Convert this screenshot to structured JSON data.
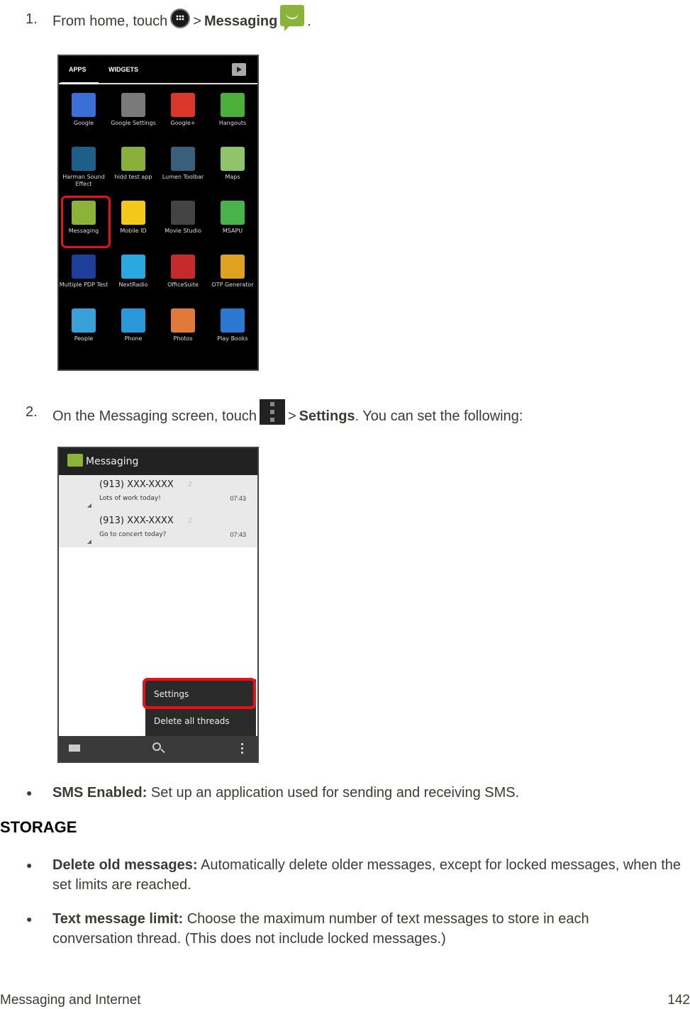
{
  "steps": [
    {
      "number": "1.",
      "prefix": "From home, touch",
      "icon1": "apps-icon",
      "separator": ">",
      "bold": "Messaging",
      "icon2": "messaging-icon",
      "suffix": "."
    },
    {
      "number": "2.",
      "prefix": "On the Messaging screen, touch",
      "icon1": "menu-icon",
      "separator": ">",
      "bold": "Settings",
      "suffix": ". You can set the following:"
    }
  ],
  "app_drawer": {
    "tabs": [
      "APPS",
      "WIDGETS"
    ],
    "apps": [
      {
        "label": "Google",
        "color": "#3b6fd8"
      },
      {
        "label": "Google Settings",
        "color": "#7a7a7a"
      },
      {
        "label": "Google+",
        "color": "#d9372a"
      },
      {
        "label": "Hangouts",
        "color": "#4caf3a"
      },
      {
        "label": "Harman Sound Effect",
        "color": "#1e5f8a"
      },
      {
        "label": "hidd test app",
        "color": "#8ab03c"
      },
      {
        "label": "Lumen Toolbar",
        "color": "#3a5f7a"
      },
      {
        "label": "Maps",
        "color": "#8fc46a"
      },
      {
        "label": "Messaging",
        "color": "#8bb33a",
        "highlighted": true
      },
      {
        "label": "Mobile ID",
        "color": "#f2c81a"
      },
      {
        "label": "Movie Studio",
        "color": "#444444"
      },
      {
        "label": "MSAPU",
        "color": "#47b34a"
      },
      {
        "label": "Multiple PDP Test",
        "color": "#1d3f9a"
      },
      {
        "label": "NextRadio",
        "color": "#2aa9e0"
      },
      {
        "label": "OfficeSuite",
        "color": "#c72a2a"
      },
      {
        "label": "OTP Generator",
        "color": "#e0a020"
      },
      {
        "label": "People",
        "color": "#3aa0d8"
      },
      {
        "label": "Phone",
        "color": "#2a98d8"
      },
      {
        "label": "Photos",
        "color": "#e07a3a"
      },
      {
        "label": "Play Books",
        "color": "#2a78d0"
      }
    ]
  },
  "messaging_screen": {
    "title": "Messaging",
    "threads": [
      {
        "contact": "(913) XXX-XXXX",
        "count": "2",
        "snippet": "Lots of work today!",
        "time": "07:43"
      },
      {
        "contact": "(913) XXX-XXXX",
        "count": "2",
        "snippet": "Go to concert today?",
        "time": "07:43"
      }
    ],
    "menu": {
      "settings": "Settings",
      "delete_all": "Delete all threads"
    }
  },
  "bullets_top": [
    {
      "term": "SMS Enabled:",
      "desc": "Set up an application used for sending and receiving SMS."
    }
  ],
  "section_heading": "STORAGE",
  "bullets_storage": [
    {
      "term": "Delete old messages:",
      "desc": "Automatically delete older messages, except for locked messages, when the set limits are reached."
    },
    {
      "term": "Text message limit:",
      "desc": "Choose the maximum number of text messages to store in each conversation thread. (This does not include locked messages.)"
    }
  ],
  "bullet_glyph": "●",
  "footer": {
    "section": "Messaging and Internet",
    "page": "142"
  }
}
